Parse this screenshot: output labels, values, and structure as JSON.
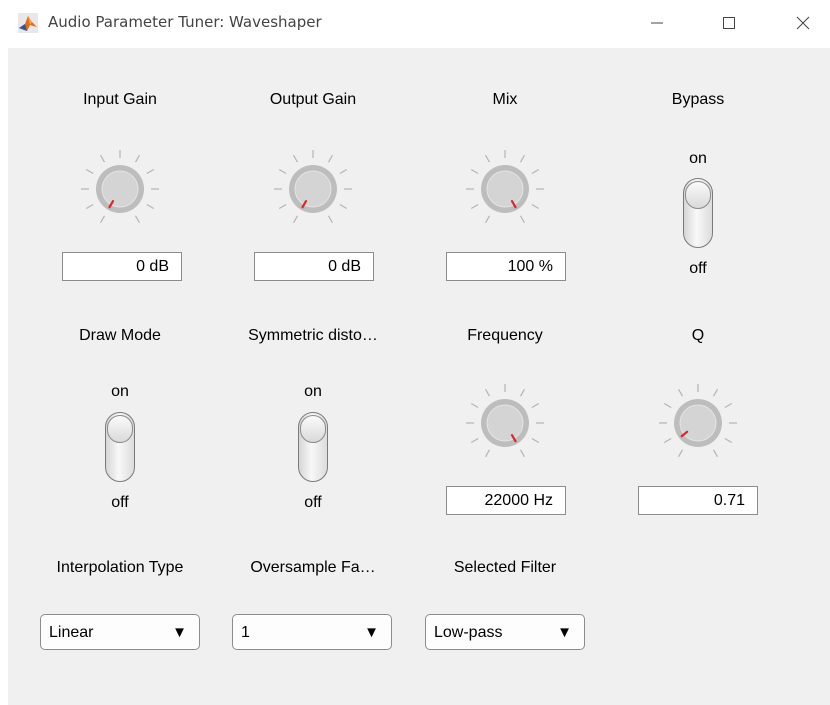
{
  "window": {
    "title": "Audio Parameter Tuner: Waveshaper",
    "minimize_glyph": "—",
    "close_glyph": "✕"
  },
  "controls": {
    "input_gain": {
      "label": "Input Gain",
      "value": "0 dB"
    },
    "output_gain": {
      "label": "Output Gain",
      "value": "0 dB"
    },
    "mix": {
      "label": "Mix",
      "value": "100 %"
    },
    "bypass": {
      "label": "Bypass",
      "on_label": "on",
      "off_label": "off",
      "state": "off"
    },
    "draw_mode": {
      "label": "Draw Mode",
      "on_label": "on",
      "off_label": "off",
      "state": "off"
    },
    "symmetric_distortion": {
      "label": "Symmetric disto…",
      "on_label": "on",
      "off_label": "off",
      "state": "off"
    },
    "frequency": {
      "label": "Frequency",
      "value": "22000 Hz"
    },
    "q": {
      "label": "Q",
      "value": "0.71"
    },
    "interpolation_type": {
      "label": "Interpolation Type",
      "selected": "Linear"
    },
    "oversample_factor": {
      "label": "Oversample Fa…",
      "selected": "1"
    },
    "selected_filter": {
      "label": "Selected Filter",
      "selected": "Low-pass"
    }
  },
  "knob_levels": {
    "input_gain": 0.0,
    "output_gain": 0.0,
    "mix": 1.0,
    "frequency": 1.0,
    "q": 0.07
  },
  "colors": {
    "knob_indicator": "#d9262a",
    "background": "#f0f0f0"
  },
  "icons": {
    "app": "matlab-icon",
    "dropdown": "▼"
  }
}
